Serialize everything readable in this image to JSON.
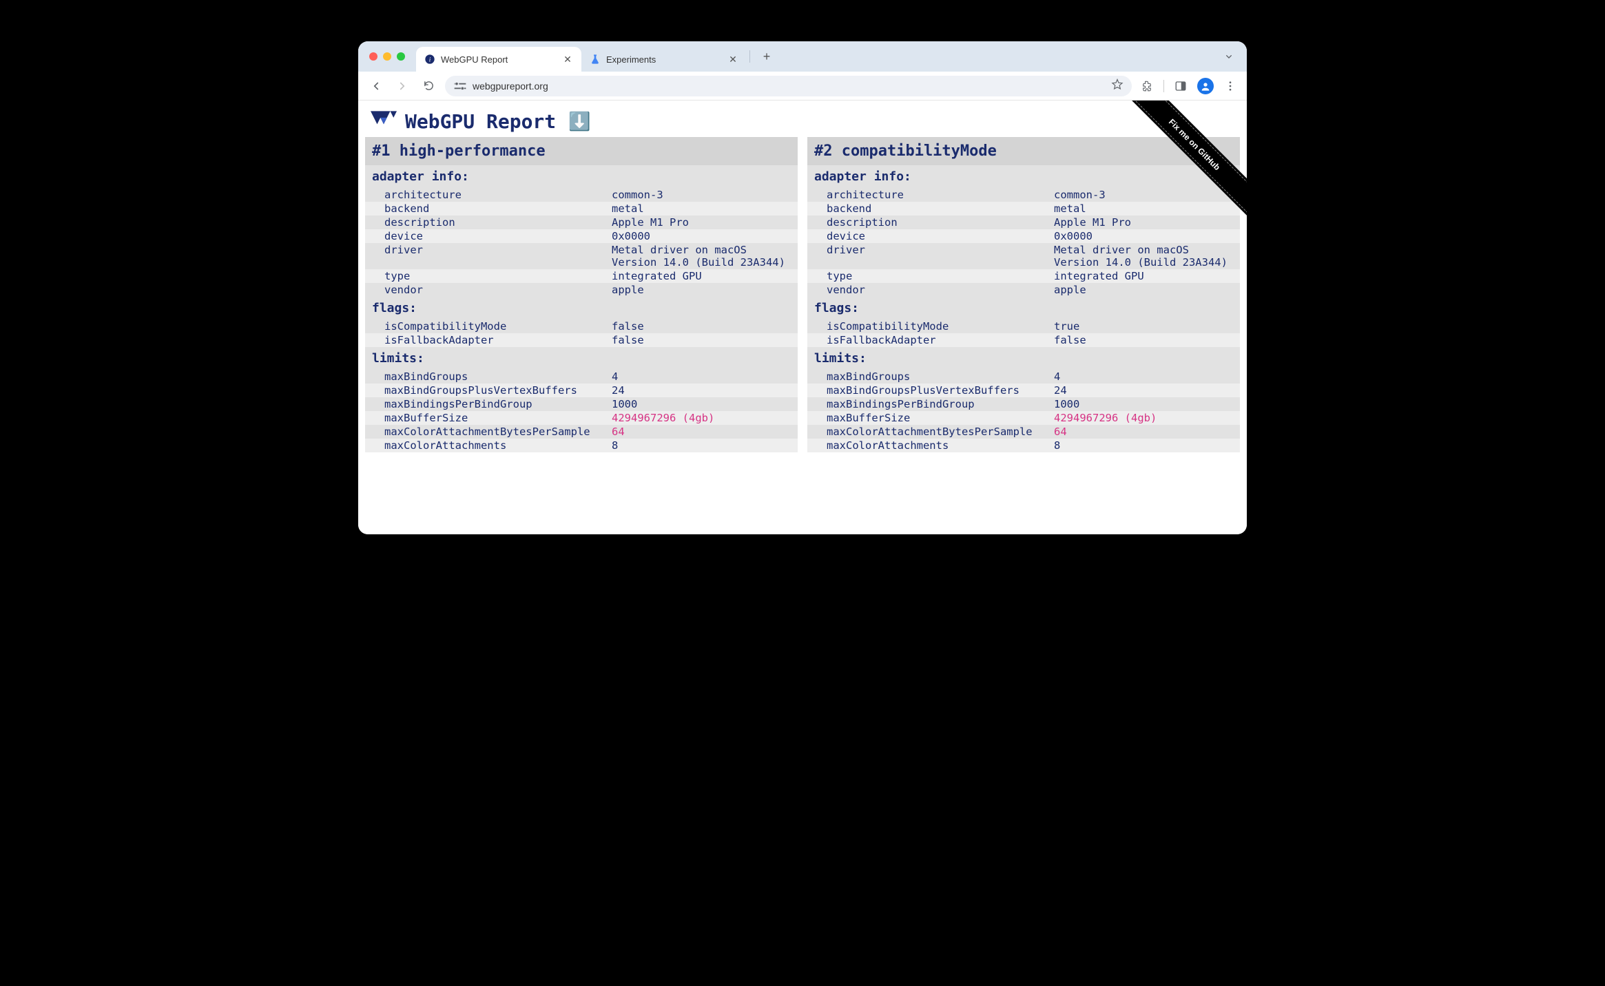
{
  "browser": {
    "tabs": [
      {
        "title": "WebGPU Report",
        "active": true,
        "icon": "webgpu"
      },
      {
        "title": "Experiments",
        "active": false,
        "icon": "flask"
      }
    ],
    "url": "webgpureport.org"
  },
  "page": {
    "title": "WebGPU Report",
    "download_icon": "⬇️",
    "github_ribbon": "Fix me on GitHub"
  },
  "adapters": [
    {
      "header": "#1 high-performance",
      "sections": [
        {
          "title": "adapter info:",
          "rows": [
            {
              "key": "architecture",
              "val": "common-3"
            },
            {
              "key": "backend",
              "val": "metal"
            },
            {
              "key": "description",
              "val": "Apple M1 Pro"
            },
            {
              "key": "device",
              "val": "0x0000"
            },
            {
              "key": "driver",
              "val": "Metal driver on macOS Version 14.0 (Build 23A344)"
            },
            {
              "key": "type",
              "val": "integrated GPU"
            },
            {
              "key": "vendor",
              "val": "apple"
            }
          ]
        },
        {
          "title": "flags:",
          "rows": [
            {
              "key": "isCompatibilityMode",
              "val": "false"
            },
            {
              "key": "isFallbackAdapter",
              "val": "false"
            }
          ]
        },
        {
          "title": "limits:",
          "rows": [
            {
              "key": "maxBindGroups",
              "val": "4"
            },
            {
              "key": "maxBindGroupsPlusVertexBuffers",
              "val": "24"
            },
            {
              "key": "maxBindingsPerBindGroup",
              "val": "1000"
            },
            {
              "key": "maxBufferSize",
              "val": "4294967296 (4gb)",
              "pink": true
            },
            {
              "key": "maxColorAttachmentBytesPerSample",
              "val": "64",
              "pink": true
            },
            {
              "key": "maxColorAttachments",
              "val": "8"
            }
          ]
        }
      ]
    },
    {
      "header": "#2 compatibilityMode",
      "sections": [
        {
          "title": "adapter info:",
          "rows": [
            {
              "key": "architecture",
              "val": "common-3"
            },
            {
              "key": "backend",
              "val": "metal"
            },
            {
              "key": "description",
              "val": "Apple M1 Pro"
            },
            {
              "key": "device",
              "val": "0x0000"
            },
            {
              "key": "driver",
              "val": "Metal driver on macOS Version 14.0 (Build 23A344)"
            },
            {
              "key": "type",
              "val": "integrated GPU"
            },
            {
              "key": "vendor",
              "val": "apple"
            }
          ]
        },
        {
          "title": "flags:",
          "rows": [
            {
              "key": "isCompatibilityMode",
              "val": "true"
            },
            {
              "key": "isFallbackAdapter",
              "val": "false"
            }
          ]
        },
        {
          "title": "limits:",
          "rows": [
            {
              "key": "maxBindGroups",
              "val": "4"
            },
            {
              "key": "maxBindGroupsPlusVertexBuffers",
              "val": "24"
            },
            {
              "key": "maxBindingsPerBindGroup",
              "val": "1000"
            },
            {
              "key": "maxBufferSize",
              "val": "4294967296 (4gb)",
              "pink": true
            },
            {
              "key": "maxColorAttachmentBytesPerSample",
              "val": "64",
              "pink": true
            },
            {
              "key": "maxColorAttachments",
              "val": "8"
            }
          ]
        }
      ]
    }
  ]
}
